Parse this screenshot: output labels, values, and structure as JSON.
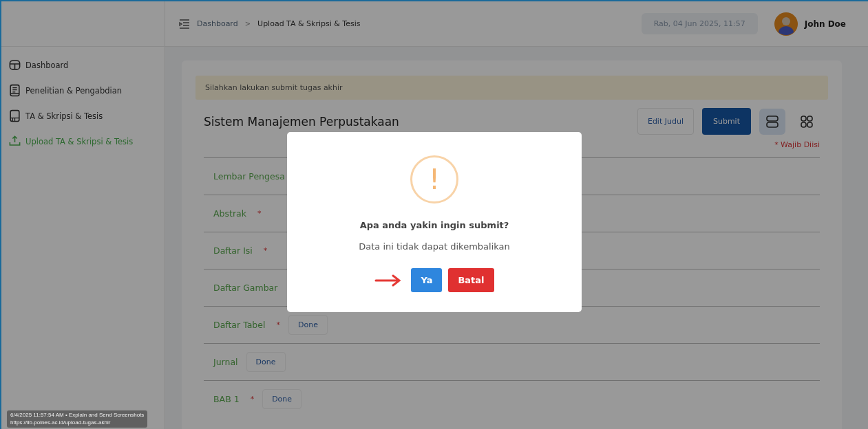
{
  "header": {
    "breadcrumb": [
      {
        "label": "Dashboard",
        "current": false
      },
      {
        "label": "Upload TA & Skripsi & Tesis",
        "current": true
      }
    ],
    "separator": ">",
    "datetime": "Rab, 04 Jun 2025, 11:57",
    "user": "John Doe"
  },
  "sidebar": {
    "items": [
      {
        "label": "Dashboard",
        "selected": false
      },
      {
        "label": "Penelitian & Pengabdian",
        "selected": false
      },
      {
        "label": "TA & Skripsi & Tesis",
        "selected": false
      },
      {
        "label": "Upload TA & Skripsi & Tesis",
        "selected": true
      }
    ]
  },
  "alert": "Silahkan lakukan submit tugas akhir",
  "title": "Sistem Manajemen Perpustakaan",
  "actions": {
    "edit": "Edit Judul",
    "submit": "Submit",
    "views": [
      {
        "kind": "list",
        "selected": true
      },
      {
        "kind": "grid",
        "selected": false
      }
    ]
  },
  "required_note": "* Wajib Diisi",
  "rows": [
    {
      "label": "Lembar Pengesa"
    },
    {
      "label": "Abstrak",
      "required": true
    },
    {
      "label": "Daftar Isi",
      "required": true
    },
    {
      "label": "Daftar Gambar"
    },
    {
      "label": "Daftar Tabel",
      "required": true,
      "done": "Done"
    },
    {
      "label": "Jurnal",
      "required": false,
      "done": "Done"
    },
    {
      "label": "BAB 1",
      "required": true,
      "done": "Done"
    }
  ],
  "required_mark": "*",
  "dialog": {
    "icon": "!",
    "title": "Apa anda yakin ingin submit?",
    "message": "Data ini tidak dapat dikembalikan",
    "confirm": "Ya",
    "cancel": "Batal"
  },
  "capture_info": {
    "line1": "6/4/2025 11:57:54 AM • Explain and Send Screenshots",
    "line2": "https://lib.polnes.ac.id/upload-tugas-akhir"
  }
}
